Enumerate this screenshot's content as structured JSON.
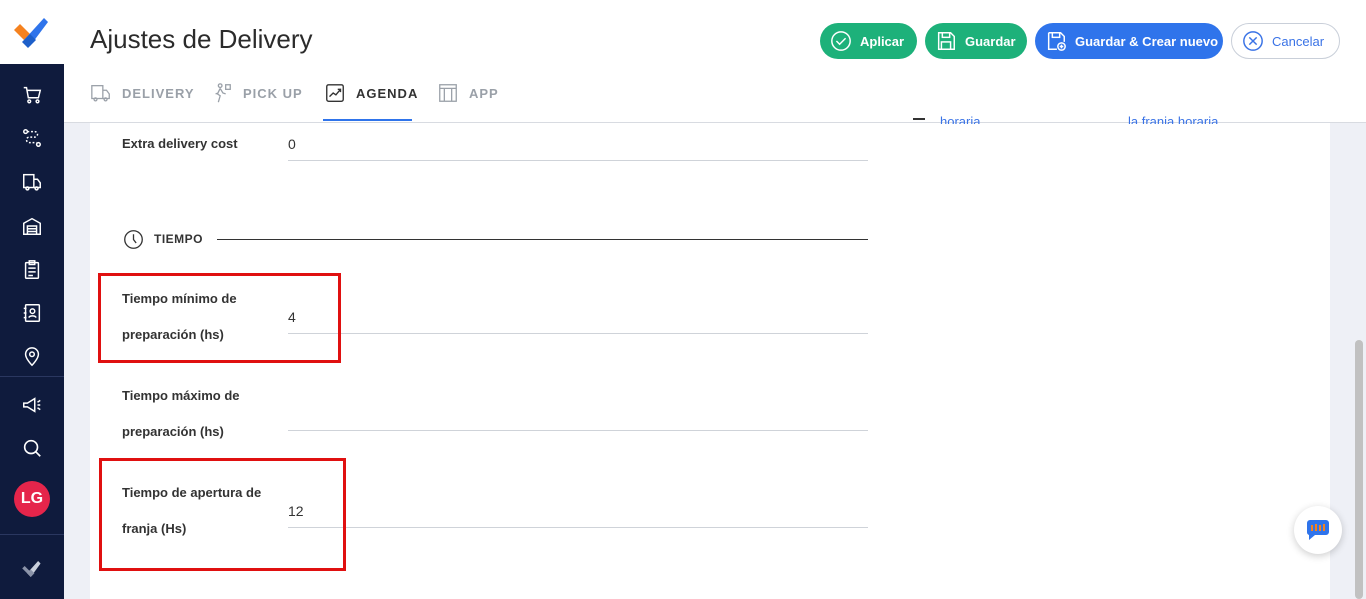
{
  "header": {
    "title": "Ajustes de Delivery",
    "buttons": {
      "aplicar": "Aplicar",
      "guardar": "Guardar",
      "guardar_crear": "Guardar & Crear nuevo",
      "cancelar": "Cancelar"
    }
  },
  "tabs": [
    {
      "label": "DELIVERY",
      "icon": "truck-icon",
      "active": false
    },
    {
      "label": "PICK UP",
      "icon": "person-walking-icon",
      "active": false
    },
    {
      "label": "AGENDA",
      "icon": "trend-chart-icon",
      "active": true
    },
    {
      "label": "APP",
      "icon": "app-window-icon",
      "active": false
    }
  ],
  "sidebar": {
    "icons": [
      "cart-icon",
      "route-icon",
      "delivery-truck-icon",
      "warehouse-icon",
      "clipboard-icon",
      "contacts-icon",
      "location-pin-icon",
      "megaphone-icon",
      "search-icon"
    ],
    "avatar_initials": "LG"
  },
  "form": {
    "extra_cost": {
      "label": "Extra delivery cost",
      "value": "0"
    },
    "section_title": "TIEMPO",
    "min_prep": {
      "label_line1": "Tiempo mínimo de",
      "label_line2": "preparación (hs)",
      "value": "4"
    },
    "max_prep": {
      "label_line1": "Tiempo máximo de",
      "label_line2": "preparación (hs)",
      "value": ""
    },
    "apertura": {
      "label_line1": "Tiempo de apertura de",
      "label_line2": "franja (Hs)",
      "value": "12"
    }
  },
  "right_column": {
    "cut_text_1": "horaria",
    "cut_text_2": "la franja horaria"
  },
  "colors": {
    "sidebar_bg": "#0f1b3d",
    "green": "#1db17a",
    "blue": "#2f74eb",
    "highlight_red": "#e01010",
    "avatar_red": "#e5254b"
  }
}
